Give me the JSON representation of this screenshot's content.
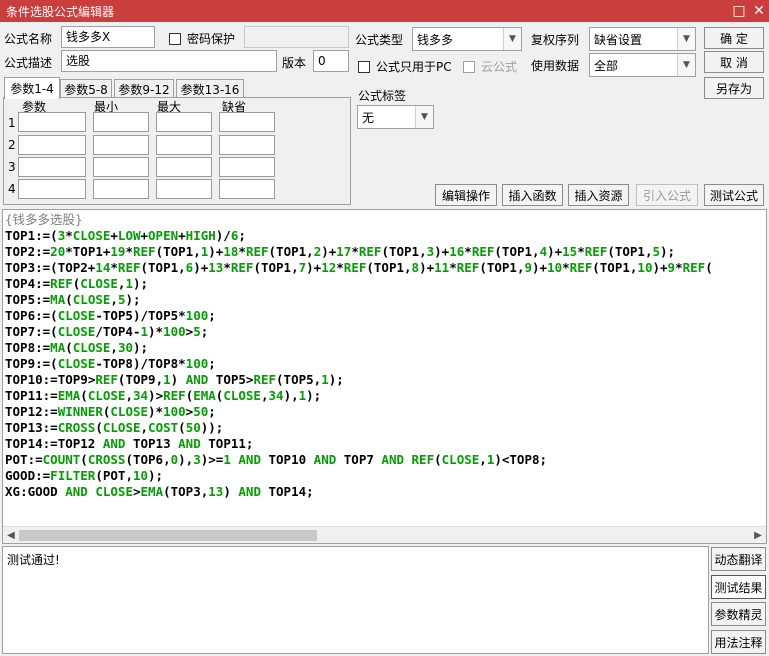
{
  "window": {
    "title": "条件选股公式编辑器",
    "maximize_icon": "□",
    "close_icon": "✕"
  },
  "form": {
    "name_label": "公式名称",
    "name_value": "钱多多X",
    "password_label": "密码保护",
    "password_value": "",
    "desc_label": "公式描述",
    "desc_value": "选股",
    "version_label": "版本",
    "version_value": "0",
    "type_label": "公式类型",
    "type_value": "钱多多",
    "rights_label": "复权序列",
    "rights_value": "缺省设置",
    "pc_only_label": "公式只用于PC",
    "cloud_label": "云公式",
    "data_label": "使用数据",
    "data_value": "全部",
    "tag_label": "公式标签",
    "tag_value": "无"
  },
  "buttons": {
    "ok": "确  定",
    "cancel": "取  消",
    "save_as": "另存为",
    "edit_ops": "编辑操作",
    "insert_func": "插入函数",
    "insert_res": "插入资源",
    "import": "引入公式",
    "test": "测试公式"
  },
  "tabs": [
    "参数1-4",
    "参数5-8",
    "参数9-12",
    "参数13-16"
  ],
  "params": {
    "headers": [
      "参数",
      "最小",
      "最大",
      "缺省"
    ],
    "rows": [
      "1",
      "2",
      "3",
      "4"
    ]
  },
  "code_lines": [
    "{钱多多选股}",
    "TOP1:=(3*CLOSE+LOW+OPEN+HIGH)/6;",
    "TOP2:=20*TOP1+19*REF(TOP1,1)+18*REF(TOP1,2)+17*REF(TOP1,3)+16*REF(TOP1,4)+15*REF(TOP1,5);",
    "TOP3:=(TOP2+14*REF(TOP1,6)+13*REF(TOP1,7)+12*REF(TOP1,8)+11*REF(TOP1,9)+10*REF(TOP1,10)+9*REF(",
    "TOP4:=REF(CLOSE,1);",
    "TOP5:=MA(CLOSE,5);",
    "TOP6:=(CLOSE-TOP5)/TOP5*100;",
    "TOP7:=(CLOSE/TOP4-1)*100>5;",
    "TOP8:=MA(CLOSE,30);",
    "TOP9:=(CLOSE-TOP8)/TOP8*100;",
    "TOP10:=TOP9>REF(TOP9,1) AND TOP5>REF(TOP5,1);",
    "TOP11:=EMA(CLOSE,34)>REF(EMA(CLOSE,34),1);",
    "TOP12:=WINNER(CLOSE)*100>50;",
    "TOP13:=CROSS(CLOSE,COST(50));",
    "TOP14:=TOP12 AND TOP13 AND TOP11;",
    "POT:=COUNT(CROSS(TOP6,0),3)>=1 AND TOP10 AND TOP7 AND REF(CLOSE,1)<TOP8;",
    "GOOD:=FILTER(POT,10);",
    "XG:GOOD AND CLOSE>EMA(TOP3,13) AND TOP14;"
  ],
  "status_text": "测试通过!",
  "side_buttons": [
    "动态翻译",
    "测试结果",
    "参数精灵",
    "用法注释"
  ],
  "colors": {
    "titlebar": "#cc3d3d",
    "code_green": "#00a000",
    "comment_gray": "#808080"
  }
}
